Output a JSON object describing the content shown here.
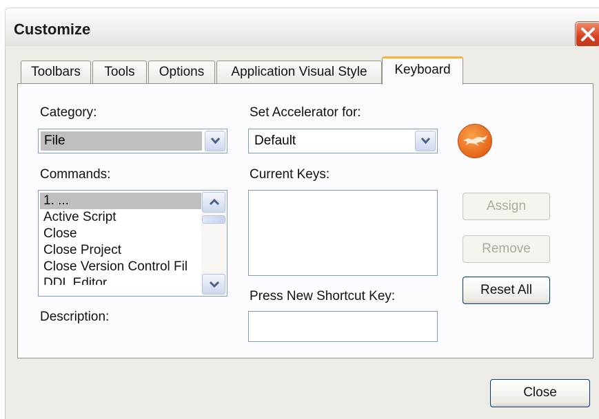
{
  "window": {
    "title": "Customize"
  },
  "tabs": [
    {
      "label": "Toolbars"
    },
    {
      "label": "Tools"
    },
    {
      "label": "Options"
    },
    {
      "label": "Application Visual Style"
    },
    {
      "label": "Keyboard"
    }
  ],
  "active_tab": "Keyboard",
  "category": {
    "label": "Category:",
    "value": "File"
  },
  "accelerator": {
    "label": "Set Accelerator for:",
    "value": "Default"
  },
  "commands": {
    "label": "Commands:",
    "items": [
      "1. ...",
      "Active Script",
      "Close",
      "Close Project",
      "Close Version Control Fil",
      "DDL Editor"
    ],
    "selected_index": 0
  },
  "current_keys": {
    "label": "Current Keys:"
  },
  "shortcut": {
    "label": "Press New Shortcut Key:",
    "value": ""
  },
  "description": {
    "label": "Description:"
  },
  "buttons": {
    "assign": "Assign",
    "remove": "Remove",
    "reset_all": "Reset All",
    "close": "Close"
  },
  "colors": {
    "active_tab_accent": "#f6b33a",
    "selection": "#bfbfc0",
    "close_button": "#d6401f"
  }
}
